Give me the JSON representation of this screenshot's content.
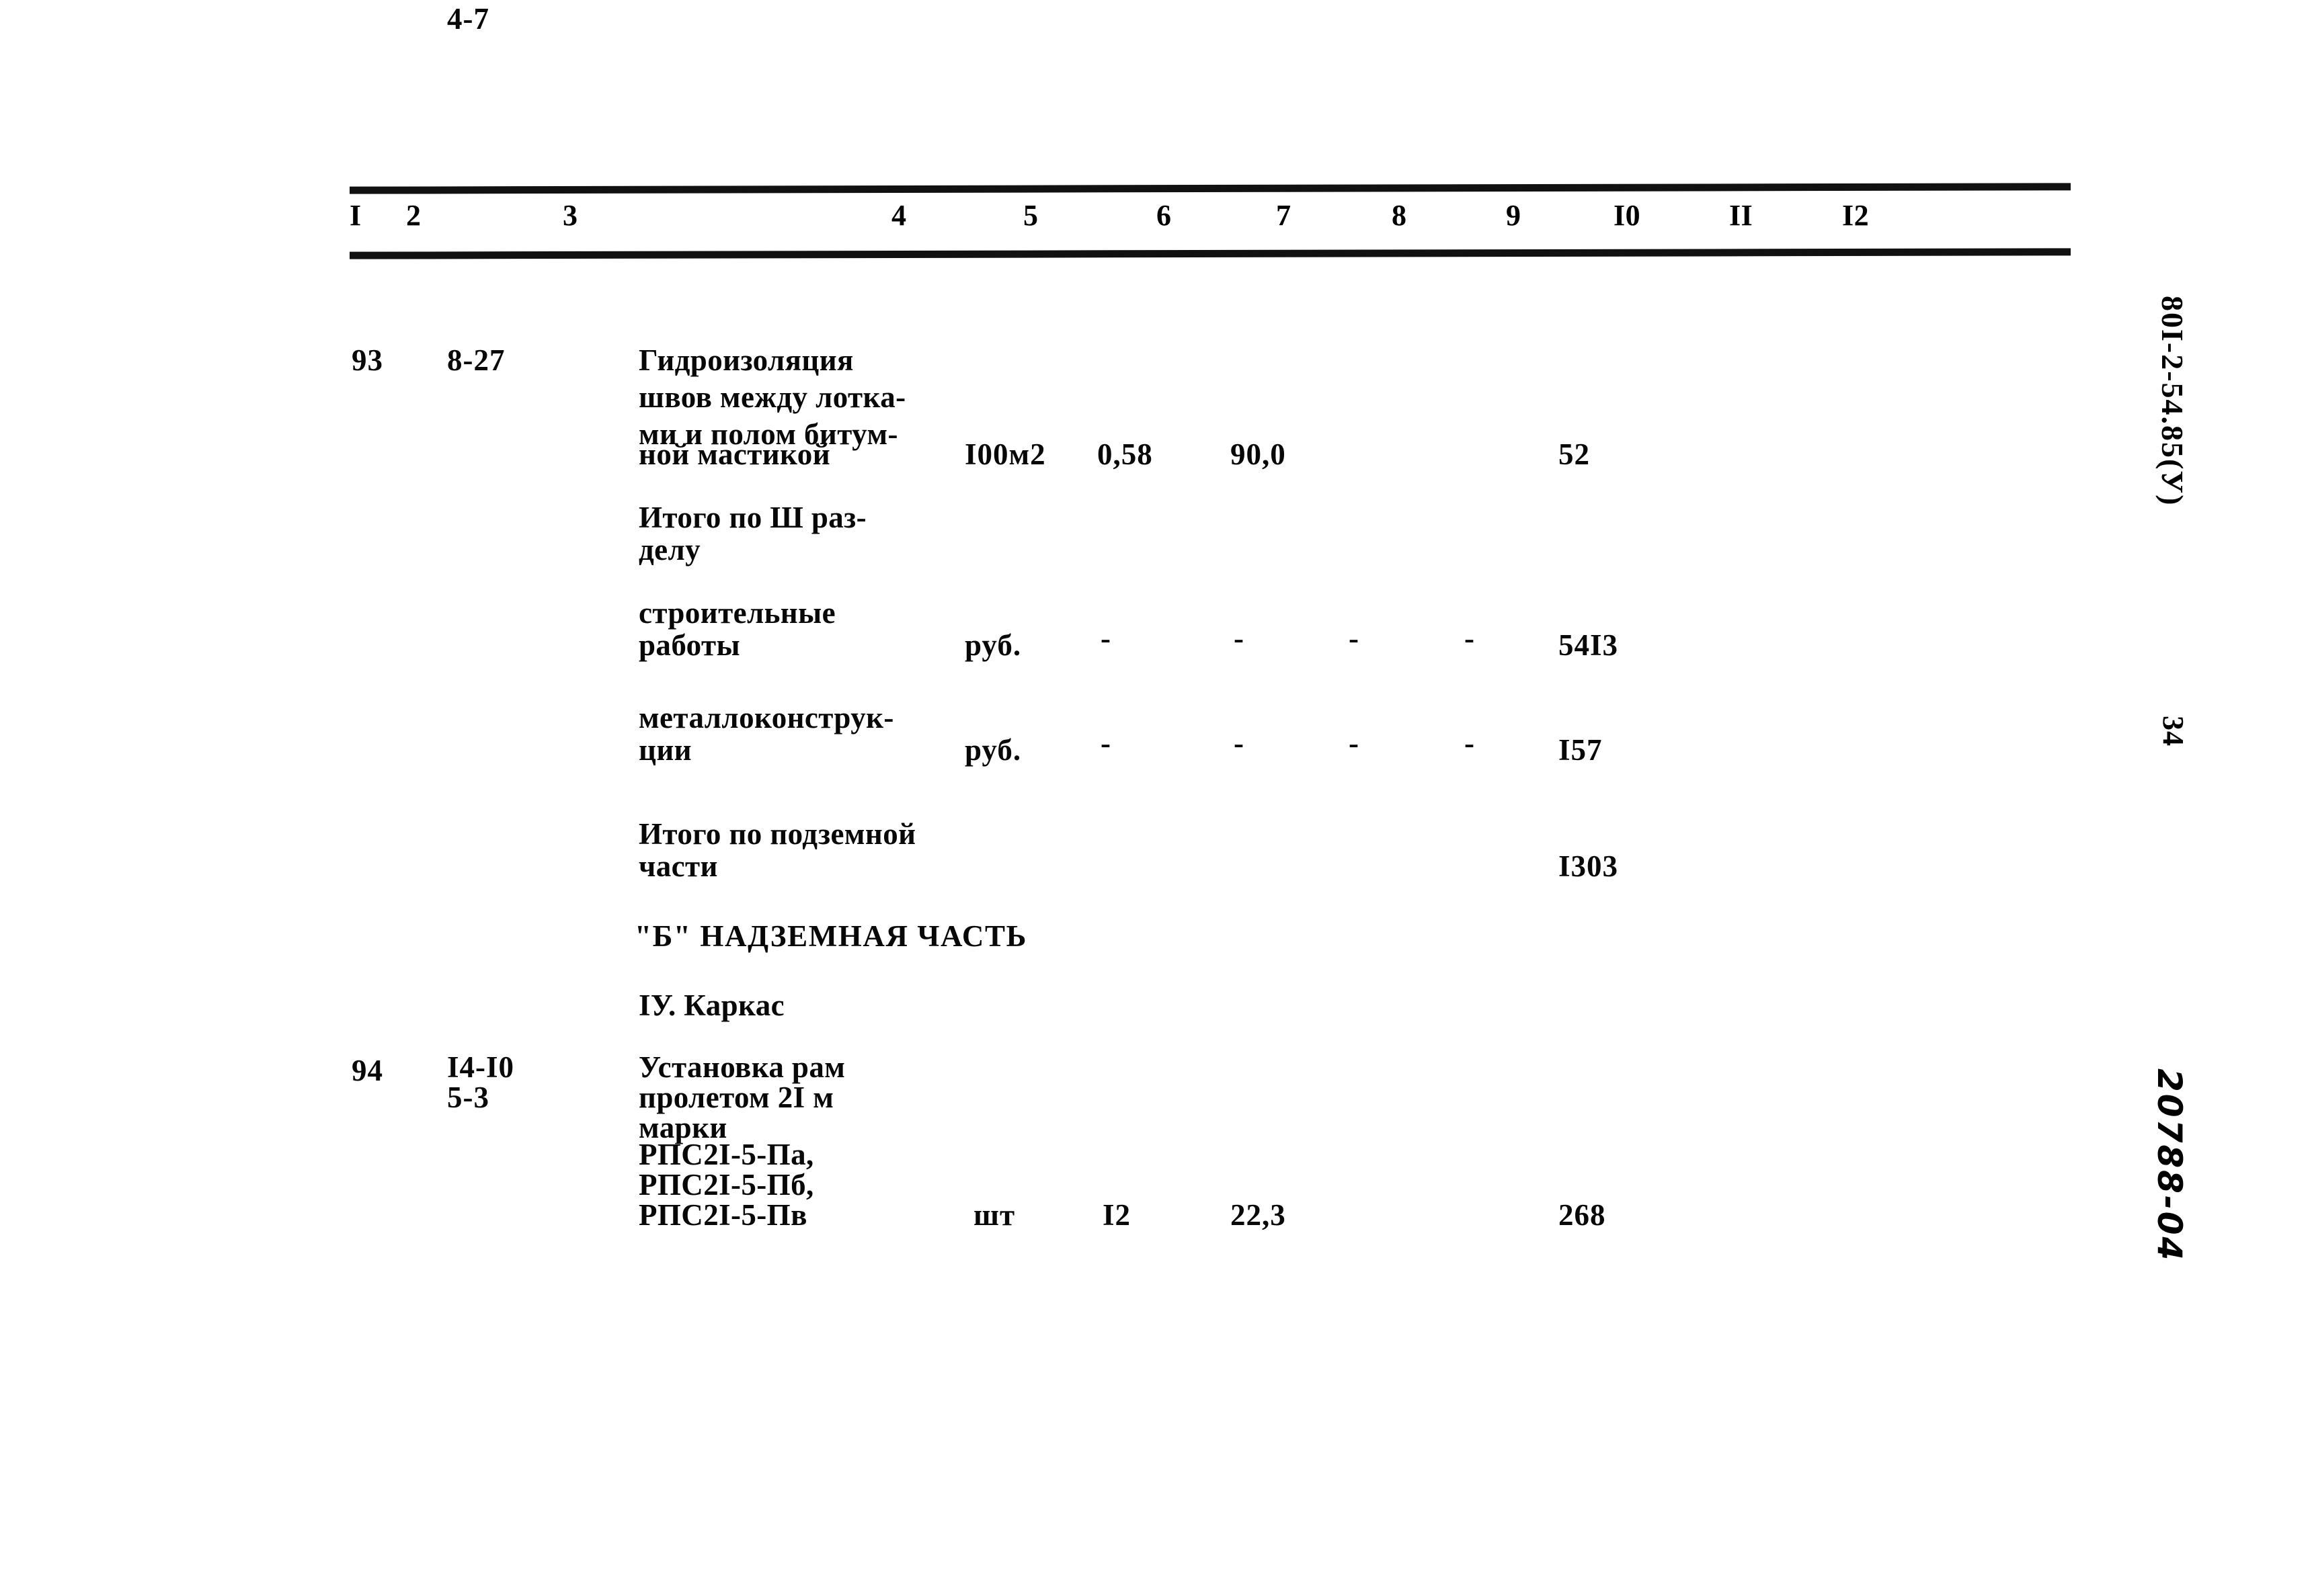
{
  "document": {
    "code_vertical": "80I-2-54.85(У)",
    "page_number": "34",
    "archive_code": "20788-04"
  },
  "table": {
    "column_headers": [
      "I",
      "2",
      "3",
      "4",
      "5",
      "6",
      "7",
      "8",
      "9",
      "I0",
      "II",
      "I2"
    ],
    "rows": [
      {
        "no": "93",
        "code_line1": "8-27",
        "code_line2": "4-7",
        "desc_lines": [
          "Гидроизоляция",
          "швов между лотка-",
          "ми и полом битум-",
          "ной мастикой"
        ],
        "unit": "I00м2",
        "col5": "0,58",
        "col6": "90,0",
        "col7": "",
        "col8": "",
        "col9": "52"
      },
      {
        "no": "",
        "code_line1": "",
        "code_line2": "",
        "desc_lines": [
          "Итого по Ш раз-",
          "делу"
        ],
        "unit": "",
        "col5": "",
        "col6": "",
        "col7": "",
        "col8": "",
        "col9": ""
      },
      {
        "no": "",
        "code_line1": "",
        "code_line2": "",
        "desc_lines": [
          "строительные",
          "работы"
        ],
        "unit": "руб.",
        "col5": "-",
        "col6": "-",
        "col7": "-",
        "col8": "-",
        "col9": "54I3"
      },
      {
        "no": "",
        "code_line1": "",
        "code_line2": "",
        "desc_lines": [
          "металлоконструк-",
          "ции"
        ],
        "unit": "руб.",
        "col5": "-",
        "col6": "-",
        "col7": "-",
        "col8": "-",
        "col9": "I57"
      },
      {
        "no": "",
        "code_line1": "",
        "code_line2": "",
        "desc_lines": [
          "Итого по подземной",
          "части"
        ],
        "unit": "",
        "col5": "",
        "col6": "",
        "col7": "",
        "col8": "",
        "col9": "I303"
      },
      {
        "no": "",
        "code_line1": "",
        "code_line2": "",
        "desc_lines": [
          "\"Б\" НАДЗЕМНАЯ ЧАСТЬ"
        ],
        "unit": "",
        "col5": "",
        "col6": "",
        "col7": "",
        "col8": "",
        "col9": ""
      },
      {
        "no": "",
        "code_line1": "",
        "code_line2": "",
        "desc_lines": [
          "IУ. Каркас"
        ],
        "unit": "",
        "col5": "",
        "col6": "",
        "col7": "",
        "col8": "",
        "col9": ""
      },
      {
        "no": "94",
        "code_line1": "I4-I0",
        "code_line2": "5-3",
        "desc_lines": [
          "Установка рам",
          "пролетом 2I м",
          "марки",
          "РПС2I-5-Па,",
          "РПС2I-5-Пб,",
          "РПС2I-5-Пв"
        ],
        "unit": "шт",
        "col5": "I2",
        "col6": "22,3",
        "col7": "",
        "col8": "",
        "col9": "268"
      }
    ]
  },
  "cells": {
    "h1": "I",
    "h2": "2",
    "h3": "3",
    "h4": "4",
    "h5": "5",
    "h6": "6",
    "h7": "7",
    "h8": "8",
    "h9": "9",
    "h10": "I0",
    "h11": "II",
    "h12": "I2",
    "r93_no": "93",
    "r93_code1": "8-27",
    "r93_code2": "4-7",
    "r93_d1": "Гидроизоляция",
    "r93_d2": "швов между лотка-",
    "r93_d3": "ми и полом битум-",
    "r93_d4": "ной мастикой",
    "r93_unit": "I00м2",
    "r93_c5": "0,58",
    "r93_c6": "90,0",
    "r93_c9": "52",
    "itogo3_l1": "Итого по Ш раз-",
    "itogo3_l2": "делу",
    "stroit_l1": "строительные",
    "stroit_l2": "работы",
    "stroit_unit": "руб.",
    "stroit_c5": "-",
    "stroit_c6": "-",
    "stroit_c7": "-",
    "stroit_c8": "-",
    "stroit_c9": "54I3",
    "metall_l1": "металлоконструк-",
    "metall_l2": "ции",
    "metall_unit": "руб.",
    "metall_c5": "-",
    "metall_c6": "-",
    "metall_c7": "-",
    "metall_c8": "-",
    "metall_c9": "I57",
    "podzem_l1": "Итого по подземной",
    "podzem_l2": "части",
    "podzem_c9": "I303",
    "section_b": "\"Б\" НАДЗЕМНАЯ ЧАСТЬ",
    "section_iv": "IУ. Каркас",
    "r94_no": "94",
    "r94_code1": "I4-I0",
    "r94_code2": "5-3",
    "r94_d1": "Установка рам",
    "r94_d2": "пролетом 2I м",
    "r94_d3": "марки",
    "r94_d4": "РПС2I-5-Па,",
    "r94_d5": "РПС2I-5-Пб,",
    "r94_d6": "РПС2I-5-Пв",
    "r94_unit": "шт",
    "r94_c5": "I2",
    "r94_c6": "22,3",
    "r94_c9": "268"
  }
}
